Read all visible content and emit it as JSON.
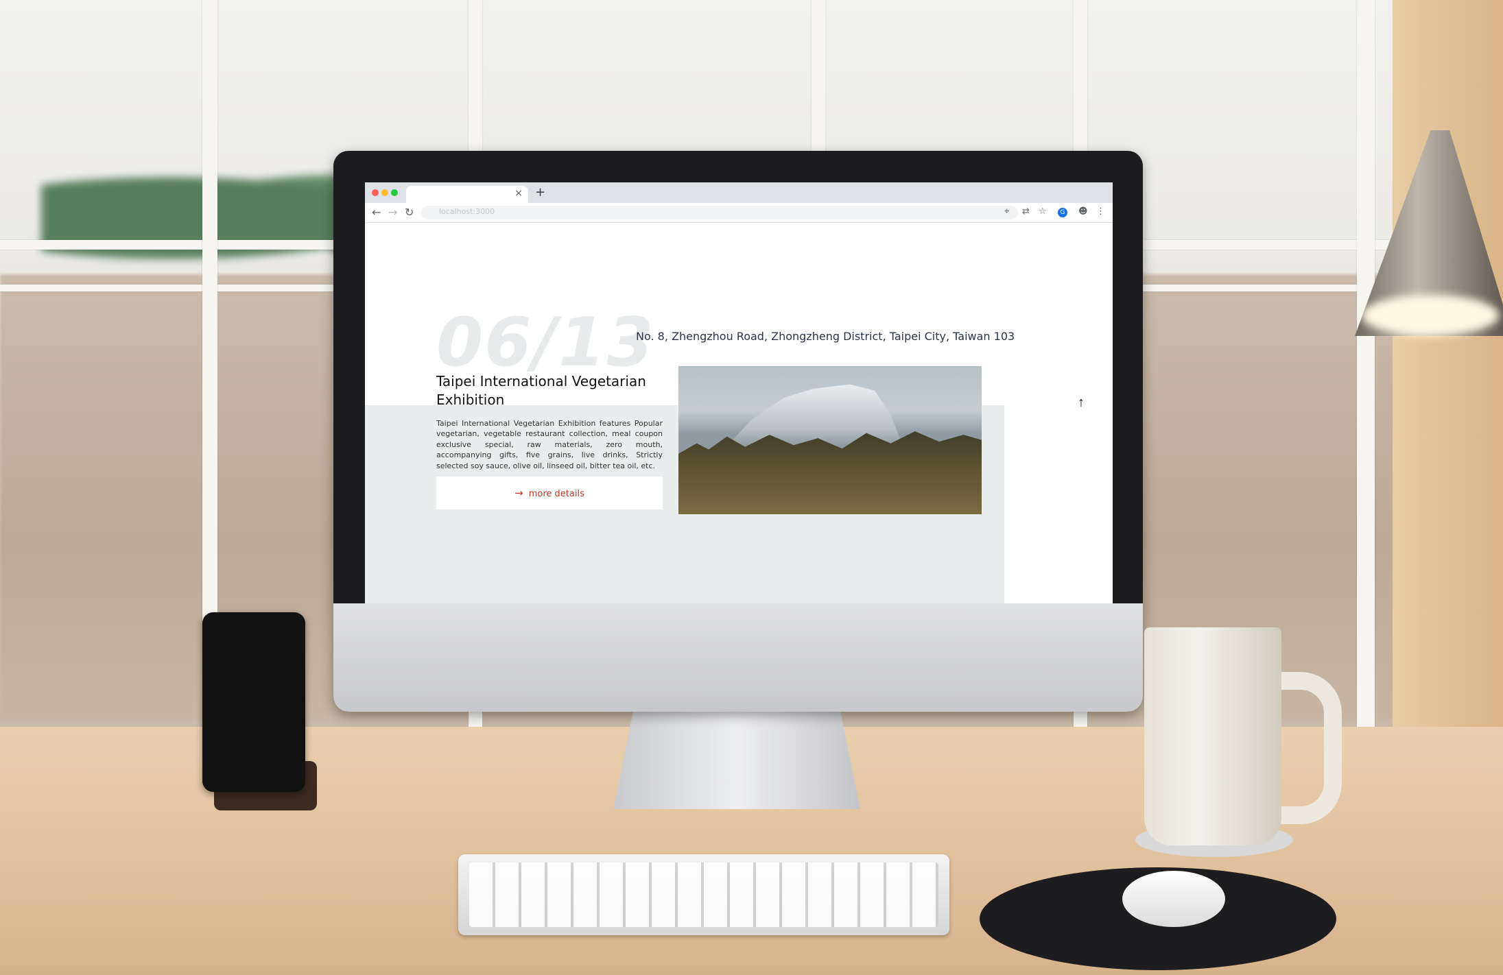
{
  "browser": {
    "url": "localhost:3000",
    "new_tab_symbol": "+",
    "close_tab_symbol": "×",
    "nav": {
      "back": "←",
      "forward": "→",
      "reload": "↻"
    },
    "toolbar_icons": {
      "location": "⌖",
      "translate": "⇄",
      "bookmark": "☆",
      "extension": "G",
      "profile": "☻",
      "menu": "⋮"
    }
  },
  "event": {
    "date": "06/13",
    "address": "No. 8, Zhengzhou Road, Zhongzheng District, Taipei City, Taiwan 103",
    "title": "Taipei International Vegetarian Exhibition",
    "description": "Taipei International Vegetarian Exhibition features Popular vegetarian, vegetable restaurant collection, meal coupon exclusive special, raw materials, zero mouth, accompanying gifts, five grains, live drinks, Strictly selected soy sauce, olive oil, linseed oil, bitter tea oil, etc.",
    "more_label": "more details",
    "more_arrow": "→"
  },
  "scroll_top_symbol": "↑",
  "device": {
    "logo": ""
  },
  "colors": {
    "accent": "#c0392b",
    "band": "#e9eded",
    "date_watermark": "#e8ebec"
  }
}
